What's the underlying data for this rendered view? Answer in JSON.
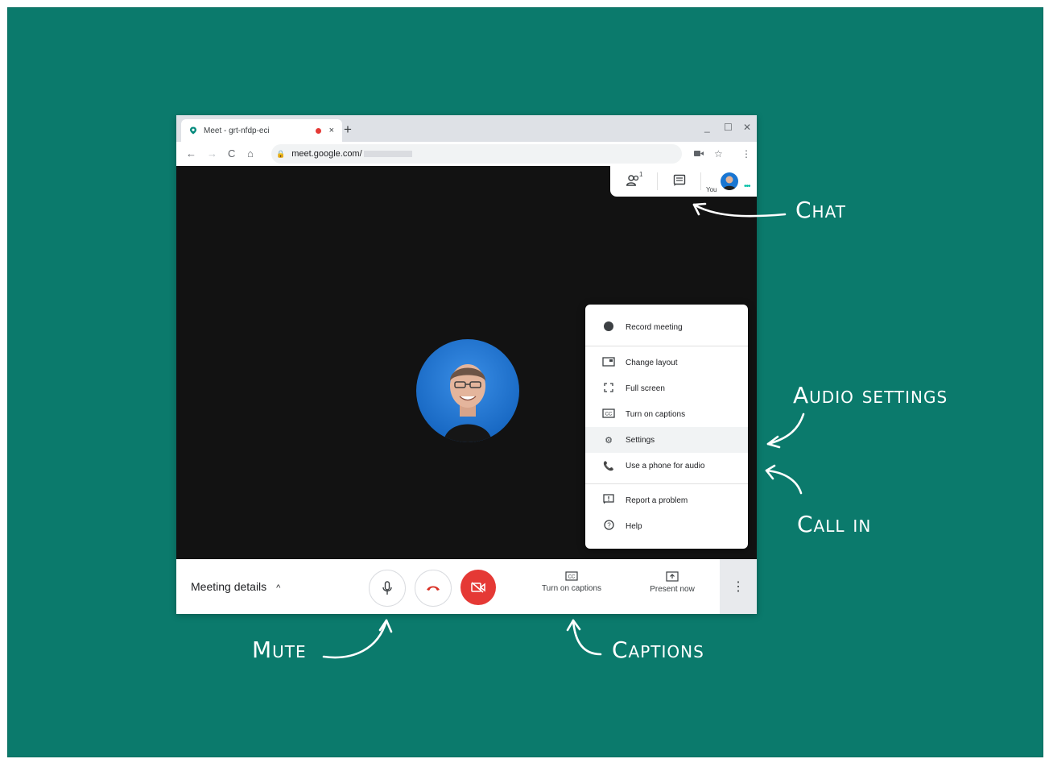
{
  "browser": {
    "tab_title": "Meet - grt-nfdp-eci",
    "tab_close": "×",
    "new_tab": "+",
    "win_min": "_",
    "win_max": "☐",
    "win_close": "✕",
    "nav_back": "←",
    "nav_forward": "→",
    "nav_reload": "C",
    "nav_home": "⌂",
    "url": "meet.google.com/",
    "star": "☆",
    "kebab": "⋮"
  },
  "meet": {
    "people_icon_count": "1",
    "you_label": "You",
    "status_dots": "•••",
    "menu": [
      {
        "label": "Record meeting",
        "icon": "record-icon"
      },
      {
        "label": "Change layout",
        "icon": "layout-icon"
      },
      {
        "label": "Full screen",
        "icon": "fullscreen-icon"
      },
      {
        "label": "Turn on captions",
        "icon": "captions-icon"
      },
      {
        "label": "Settings",
        "icon": "gear-icon"
      },
      {
        "label": "Use a phone for audio",
        "icon": "phone-icon"
      },
      {
        "label": "Report a problem",
        "icon": "report-icon"
      },
      {
        "label": "Help",
        "icon": "help-icon"
      }
    ],
    "bottom": {
      "meeting_details": "Meeting details",
      "chevron": "^",
      "captions_label": "Turn on captions",
      "present_label": "Present now",
      "more": "⋮"
    }
  },
  "annotations": {
    "chat": "Chat",
    "audio_settings": "Audio settings",
    "call_in": "Call in",
    "mute": "Mute",
    "captions": "Captions"
  },
  "colors": {
    "background": "#0b7a6c",
    "stage": "#121212",
    "danger": "#e53935"
  }
}
